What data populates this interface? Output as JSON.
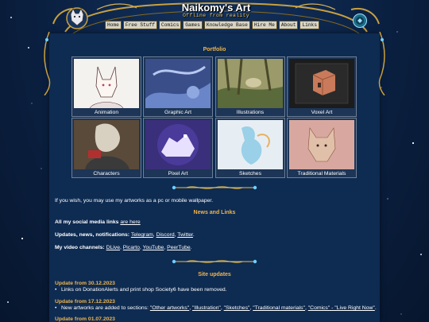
{
  "header": {
    "title": "Naikomy's Art",
    "subtitle": "Offline from reality"
  },
  "nav": [
    {
      "label": "Home"
    },
    {
      "label": "Free Stuff"
    },
    {
      "label": "Comics"
    },
    {
      "label": "Games"
    },
    {
      "label": "Knowledge Base"
    },
    {
      "label": "Hire Me"
    },
    {
      "label": "About"
    },
    {
      "label": "Links"
    }
  ],
  "portfolio": {
    "title": "Portfolio",
    "tiles": [
      {
        "label": "Animation"
      },
      {
        "label": "Graphic Art"
      },
      {
        "label": "Illustrations"
      },
      {
        "label": "Voxel Art"
      },
      {
        "label": "Characters"
      },
      {
        "label": "Pixel Art"
      },
      {
        "label": "Sketches"
      },
      {
        "label": "Traditional Materials"
      }
    ],
    "wallpaper_note": "If you wish, you may use my artworks as a pc or mobile wallpaper."
  },
  "news": {
    "title": "News and Links",
    "social": {
      "label": "All my social media links",
      "link": "are here"
    },
    "updates": {
      "label": "Updates, news, notifications:",
      "links": [
        "Telegram",
        "Discord",
        "Twitter"
      ]
    },
    "video": {
      "label": "My video channels:",
      "links": [
        "DLive",
        "Picarto",
        "YouTube",
        "PeerTube"
      ]
    }
  },
  "site_updates": {
    "title": "Site updates",
    "entries": [
      {
        "date": "Update from 30.12.2023",
        "text": "Links on DonationAlerts and print shop Society6 have been removed."
      },
      {
        "date": "Update from 17.12.2023",
        "prefix": "New artworks are added to sections:",
        "links": [
          "\"Other artworks\"",
          "\"Illustration\"",
          "\"Sketches\"",
          "\"Traditional materials\"",
          "\"Comics\" - \"Live Right Now\""
        ]
      },
      {
        "date": "Update from 01.07.2023"
      }
    ]
  },
  "colors": {
    "background": "#0a1f3f",
    "panel": "#0e2b52",
    "accent": "#f0b54a",
    "gold": "#c9a040"
  }
}
